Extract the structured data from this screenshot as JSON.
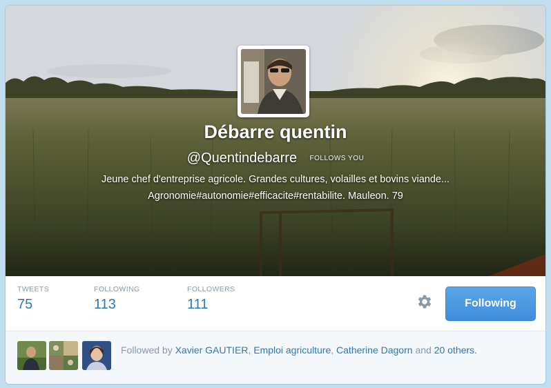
{
  "profile": {
    "name": "Débarre quentin",
    "handle": "@Quentindebarre",
    "follows_you": "FOLLOWS YOU",
    "bio_line1": "Jeune chef d'entreprise agricole. Grandes cultures, volailles et bovins viande...",
    "bio_line2": "Agronomie#autonomie#efficacite#rentabilite. Mauleon. 79"
  },
  "stats": [
    {
      "label": "TWEETS",
      "value": "75"
    },
    {
      "label": "FOLLOWING",
      "value": "113"
    },
    {
      "label": "FOLLOWERS",
      "value": "111"
    }
  ],
  "actions": {
    "follow_label": "Following"
  },
  "followed_by": {
    "prefix": "Followed by",
    "names": [
      "Xavier GAUTIER",
      "Emploi agriculture",
      "Catherine Dagorn"
    ],
    "sep1": ",",
    "sep2": ",",
    "and": "and",
    "others": "20 others."
  },
  "colors": {
    "accent": "#2a78b6",
    "button": "#4a99e0",
    "page_background": "#c0deed",
    "muted_text": "#8899a6"
  },
  "icons": {
    "settings": "gear-icon"
  }
}
